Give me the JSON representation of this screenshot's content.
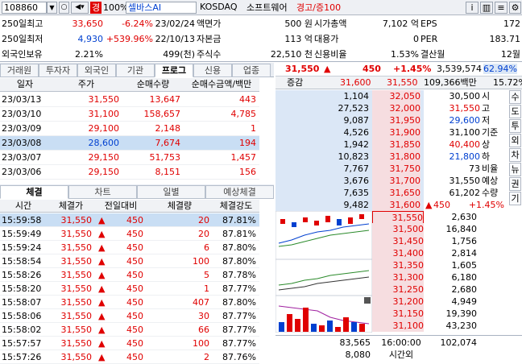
{
  "topbar": {
    "code": "108860",
    "badge_warn": "경",
    "pct_label": "100%",
    "name": "셀바스AI",
    "market": "KOSDAQ",
    "sector": "소프트웨어",
    "status": "경고/증100",
    "icons": [
      "chevron-down-icon",
      "speaker-icon",
      "search-icon",
      "info-icon",
      "chart-icon",
      "gear-icon"
    ]
  },
  "info": {
    "rows": [
      [
        "250일최고",
        "33,650",
        "-6.24%",
        "23/02/24",
        "액면가",
        "500 원",
        "시가총액",
        "7,102 억",
        "EPS",
        "172"
      ],
      [
        "250일최저",
        "4,930",
        "+539.96%",
        "22/10/13",
        "자본금",
        "113 억",
        "대용가",
        "0",
        "PER",
        "183.71"
      ],
      [
        "외국인보유",
        "2.21%",
        "",
        "499(천)",
        "주식수",
        "22,510 천",
        "신용비율",
        "1.53%",
        "결산월",
        "12월"
      ]
    ]
  },
  "left_tabs": [
    "거래원",
    "투자자",
    "외국인",
    "기관",
    "프로그",
    "신용",
    "업종"
  ],
  "program": {
    "headers": [
      "일자",
      "주가",
      "순매수량",
      "순매수금액/백만"
    ],
    "rows": [
      [
        "23/03/13",
        "31,550",
        "13,647",
        "443"
      ],
      [
        "23/03/10",
        "31,100",
        "158,657",
        "4,785"
      ],
      [
        "23/03/09",
        "29,100",
        "2,148",
        "1"
      ],
      [
        "23/03/08",
        "28,600",
        "7,674",
        "194"
      ],
      [
        "23/03/07",
        "29,150",
        "51,753",
        "1,457"
      ],
      [
        "23/03/06",
        "29,150",
        "8,151",
        "156"
      ]
    ]
  },
  "bottom_tabs": [
    "체결",
    "차트",
    "일별",
    "예상체결"
  ],
  "trades": {
    "headers": [
      "시간",
      "체결가",
      "전일대비",
      "체결량",
      "체결강도"
    ],
    "arrow": "▲",
    "rows": [
      [
        "15:59:58",
        "31,550",
        "450",
        "20",
        "87.81%"
      ],
      [
        "15:59:49",
        "31,550",
        "450",
        "20",
        "87.81%"
      ],
      [
        "15:59:24",
        "31,550",
        "450",
        "6",
        "87.80%"
      ],
      [
        "15:58:54",
        "31,550",
        "450",
        "100",
        "87.80%"
      ],
      [
        "15:58:26",
        "31,550",
        "450",
        "5",
        "87.78%"
      ],
      [
        "15:58:20",
        "31,550",
        "450",
        "1",
        "87.77%"
      ],
      [
        "15:58:07",
        "31,550",
        "450",
        "407",
        "87.80%"
      ],
      [
        "15:58:06",
        "31,550",
        "450",
        "30",
        "87.77%"
      ],
      [
        "15:58:02",
        "31,550",
        "450",
        "66",
        "87.77%"
      ],
      [
        "15:57:57",
        "31,550",
        "450",
        "100",
        "87.77%"
      ],
      [
        "15:57:26",
        "31,550",
        "450",
        "2",
        "87.76%"
      ]
    ]
  },
  "quote": {
    "price": "31,550",
    "arrow": "▲",
    "change": "450",
    "change_pct": "+1.45%",
    "volume": "3,539,574",
    "volume_pct": "62.94%",
    "sub_label": "증감",
    "sub_price1": "31,600",
    "sub_price2": "31,550",
    "sub_volume": "109,366백만",
    "sub_pct": "15.72%"
  },
  "orderbook": {
    "asks": [
      [
        "1,104",
        "32,050"
      ],
      [
        "27,523",
        "32,000"
      ],
      [
        "9,087",
        "31,950"
      ],
      [
        "4,526",
        "31,900"
      ],
      [
        "1,942",
        "31,850"
      ],
      [
        "10,823",
        "31,800"
      ],
      [
        "7,767",
        "31,750"
      ],
      [
        "3,676",
        "31,700"
      ],
      [
        "7,635",
        "31,650"
      ],
      [
        "9,482",
        "31,600"
      ]
    ],
    "bids": [
      [
        "31,550",
        "2,630"
      ],
      [
        "31,500",
        "16,840"
      ],
      [
        "31,450",
        "1,756"
      ],
      [
        "31,400",
        "2,814"
      ],
      [
        "31,350",
        "1,605"
      ],
      [
        "31,300",
        "6,180"
      ],
      [
        "31,250",
        "2,680"
      ],
      [
        "31,200",
        "4,949"
      ],
      [
        "31,150",
        "19,390"
      ],
      [
        "31,100",
        "43,230"
      ]
    ],
    "totals": {
      "ask_total": "83,565",
      "time_label": "16:00:00",
      "bid_total": "102,074",
      "ask_after": "8,080",
      "after_label": "시간외"
    },
    "side_info": [
      [
        "30,500",
        "시"
      ],
      [
        "31,550",
        "고"
      ],
      [
        "29,600",
        "저"
      ],
      [
        "31,100",
        "기준"
      ],
      [
        "40,400",
        "상"
      ],
      [
        "21,800",
        "하"
      ],
      [
        "73",
        "비율"
      ],
      [
        "31,550",
        "예상"
      ],
      [
        "61,202",
        "수량"
      ]
    ],
    "expected_change": "450",
    "expected_pct": "+1.45%",
    "vertical_buttons": [
      "수",
      "도",
      "투",
      "외",
      "차",
      "뉴",
      "권",
      "기"
    ]
  }
}
